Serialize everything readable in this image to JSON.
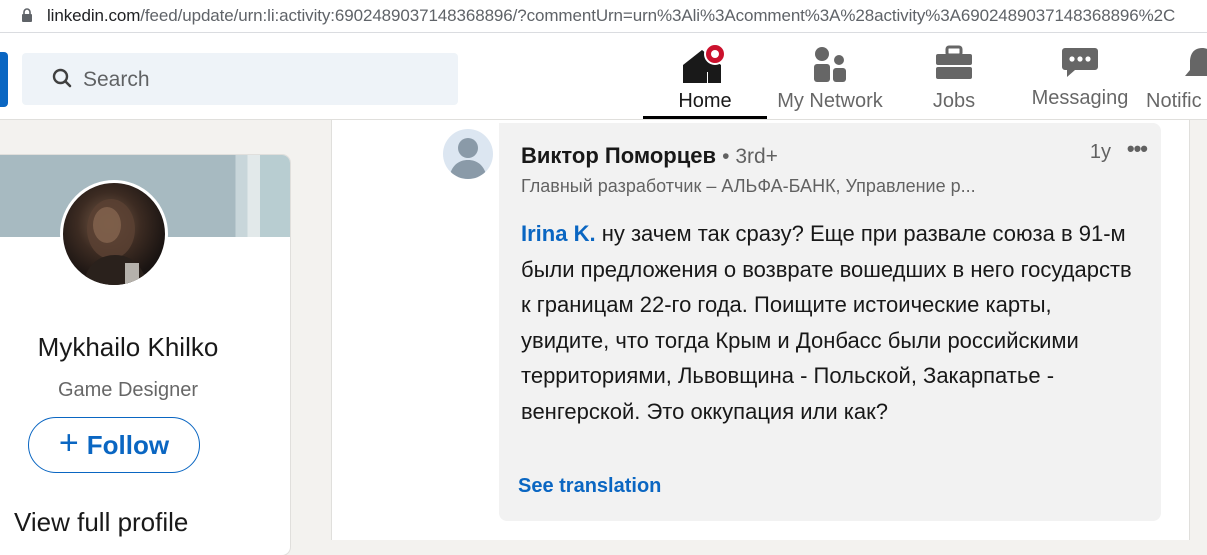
{
  "browser": {
    "url_host": "linkedin.com",
    "url_rest": "/feed/update/urn:li:activity:6902489037148368896/?commentUrn=urn%3Ali%3Acomment%3A%28activity%3A6902489037148368896%2C"
  },
  "search": {
    "placeholder": "Search"
  },
  "nav": {
    "home": "Home",
    "network": "My Network",
    "jobs": "Jobs",
    "messaging": "Messaging",
    "notifications": "Notific"
  },
  "profile": {
    "name": "Mykhailo Khilko",
    "title": "Game Designer",
    "follow_plus": "+",
    "follow_label": "Follow",
    "view_full_profile": "View full profile"
  },
  "comment": {
    "author": "Виктор Поморцев",
    "degree": "• 3rd+",
    "time": "1y",
    "more": "•••",
    "headline": "Главный разработчик – АЛЬФА-БАНК, Управление р...",
    "mention": "Irina K.",
    "text": " ну зачем так сразу? Еще при развале союза в 91-м были предложения о возврате вошедших в него государств к границам 22-го года. Поищите истоические карты, увидите, что тогда Крым и Донбасс были российскими территориями, Львовщина - Польской, Закарпатье - венгерской. Это оккупация или как?",
    "see_translation": "See translation"
  },
  "colors": {
    "brand_blue": "#0a66c2",
    "notification_red": "#cb112d",
    "page_bg": "#f3f2ef",
    "search_bg": "#eef3f8",
    "comment_bg": "#f2f2f2"
  },
  "icons": [
    "lock-icon",
    "search-icon",
    "home-icon",
    "my-network-icon",
    "jobs-icon",
    "messaging-icon",
    "notifications-icon"
  ]
}
